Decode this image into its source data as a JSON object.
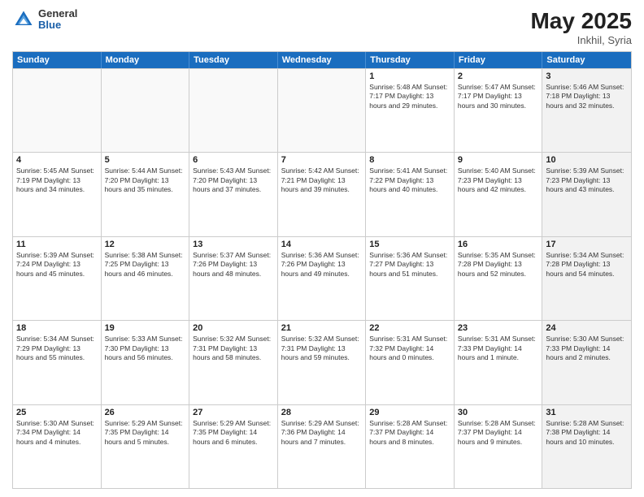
{
  "header": {
    "logo_general": "General",
    "logo_blue": "Blue",
    "month_title": "May 2025",
    "location": "Inkhil, Syria"
  },
  "days": [
    "Sunday",
    "Monday",
    "Tuesday",
    "Wednesday",
    "Thursday",
    "Friday",
    "Saturday"
  ],
  "weeks": [
    [
      {
        "day": "",
        "text": "",
        "shaded": false,
        "empty": true
      },
      {
        "day": "",
        "text": "",
        "shaded": false,
        "empty": true
      },
      {
        "day": "",
        "text": "",
        "shaded": false,
        "empty": true
      },
      {
        "day": "",
        "text": "",
        "shaded": false,
        "empty": true
      },
      {
        "day": "1",
        "text": "Sunrise: 5:48 AM\nSunset: 7:17 PM\nDaylight: 13 hours\nand 29 minutes.",
        "shaded": false,
        "empty": false
      },
      {
        "day": "2",
        "text": "Sunrise: 5:47 AM\nSunset: 7:17 PM\nDaylight: 13 hours\nand 30 minutes.",
        "shaded": false,
        "empty": false
      },
      {
        "day": "3",
        "text": "Sunrise: 5:46 AM\nSunset: 7:18 PM\nDaylight: 13 hours\nand 32 minutes.",
        "shaded": true,
        "empty": false
      }
    ],
    [
      {
        "day": "4",
        "text": "Sunrise: 5:45 AM\nSunset: 7:19 PM\nDaylight: 13 hours\nand 34 minutes.",
        "shaded": false,
        "empty": false
      },
      {
        "day": "5",
        "text": "Sunrise: 5:44 AM\nSunset: 7:20 PM\nDaylight: 13 hours\nand 35 minutes.",
        "shaded": false,
        "empty": false
      },
      {
        "day": "6",
        "text": "Sunrise: 5:43 AM\nSunset: 7:20 PM\nDaylight: 13 hours\nand 37 minutes.",
        "shaded": false,
        "empty": false
      },
      {
        "day": "7",
        "text": "Sunrise: 5:42 AM\nSunset: 7:21 PM\nDaylight: 13 hours\nand 39 minutes.",
        "shaded": false,
        "empty": false
      },
      {
        "day": "8",
        "text": "Sunrise: 5:41 AM\nSunset: 7:22 PM\nDaylight: 13 hours\nand 40 minutes.",
        "shaded": false,
        "empty": false
      },
      {
        "day": "9",
        "text": "Sunrise: 5:40 AM\nSunset: 7:23 PM\nDaylight: 13 hours\nand 42 minutes.",
        "shaded": false,
        "empty": false
      },
      {
        "day": "10",
        "text": "Sunrise: 5:39 AM\nSunset: 7:23 PM\nDaylight: 13 hours\nand 43 minutes.",
        "shaded": true,
        "empty": false
      }
    ],
    [
      {
        "day": "11",
        "text": "Sunrise: 5:39 AM\nSunset: 7:24 PM\nDaylight: 13 hours\nand 45 minutes.",
        "shaded": false,
        "empty": false
      },
      {
        "day": "12",
        "text": "Sunrise: 5:38 AM\nSunset: 7:25 PM\nDaylight: 13 hours\nand 46 minutes.",
        "shaded": false,
        "empty": false
      },
      {
        "day": "13",
        "text": "Sunrise: 5:37 AM\nSunset: 7:26 PM\nDaylight: 13 hours\nand 48 minutes.",
        "shaded": false,
        "empty": false
      },
      {
        "day": "14",
        "text": "Sunrise: 5:36 AM\nSunset: 7:26 PM\nDaylight: 13 hours\nand 49 minutes.",
        "shaded": false,
        "empty": false
      },
      {
        "day": "15",
        "text": "Sunrise: 5:36 AM\nSunset: 7:27 PM\nDaylight: 13 hours\nand 51 minutes.",
        "shaded": false,
        "empty": false
      },
      {
        "day": "16",
        "text": "Sunrise: 5:35 AM\nSunset: 7:28 PM\nDaylight: 13 hours\nand 52 minutes.",
        "shaded": false,
        "empty": false
      },
      {
        "day": "17",
        "text": "Sunrise: 5:34 AM\nSunset: 7:28 PM\nDaylight: 13 hours\nand 54 minutes.",
        "shaded": true,
        "empty": false
      }
    ],
    [
      {
        "day": "18",
        "text": "Sunrise: 5:34 AM\nSunset: 7:29 PM\nDaylight: 13 hours\nand 55 minutes.",
        "shaded": false,
        "empty": false
      },
      {
        "day": "19",
        "text": "Sunrise: 5:33 AM\nSunset: 7:30 PM\nDaylight: 13 hours\nand 56 minutes.",
        "shaded": false,
        "empty": false
      },
      {
        "day": "20",
        "text": "Sunrise: 5:32 AM\nSunset: 7:31 PM\nDaylight: 13 hours\nand 58 minutes.",
        "shaded": false,
        "empty": false
      },
      {
        "day": "21",
        "text": "Sunrise: 5:32 AM\nSunset: 7:31 PM\nDaylight: 13 hours\nand 59 minutes.",
        "shaded": false,
        "empty": false
      },
      {
        "day": "22",
        "text": "Sunrise: 5:31 AM\nSunset: 7:32 PM\nDaylight: 14 hours\nand 0 minutes.",
        "shaded": false,
        "empty": false
      },
      {
        "day": "23",
        "text": "Sunrise: 5:31 AM\nSunset: 7:33 PM\nDaylight: 14 hours\nand 1 minute.",
        "shaded": false,
        "empty": false
      },
      {
        "day": "24",
        "text": "Sunrise: 5:30 AM\nSunset: 7:33 PM\nDaylight: 14 hours\nand 2 minutes.",
        "shaded": true,
        "empty": false
      }
    ],
    [
      {
        "day": "25",
        "text": "Sunrise: 5:30 AM\nSunset: 7:34 PM\nDaylight: 14 hours\nand 4 minutes.",
        "shaded": false,
        "empty": false
      },
      {
        "day": "26",
        "text": "Sunrise: 5:29 AM\nSunset: 7:35 PM\nDaylight: 14 hours\nand 5 minutes.",
        "shaded": false,
        "empty": false
      },
      {
        "day": "27",
        "text": "Sunrise: 5:29 AM\nSunset: 7:35 PM\nDaylight: 14 hours\nand 6 minutes.",
        "shaded": false,
        "empty": false
      },
      {
        "day": "28",
        "text": "Sunrise: 5:29 AM\nSunset: 7:36 PM\nDaylight: 14 hours\nand 7 minutes.",
        "shaded": false,
        "empty": false
      },
      {
        "day": "29",
        "text": "Sunrise: 5:28 AM\nSunset: 7:37 PM\nDaylight: 14 hours\nand 8 minutes.",
        "shaded": false,
        "empty": false
      },
      {
        "day": "30",
        "text": "Sunrise: 5:28 AM\nSunset: 7:37 PM\nDaylight: 14 hours\nand 9 minutes.",
        "shaded": false,
        "empty": false
      },
      {
        "day": "31",
        "text": "Sunrise: 5:28 AM\nSunset: 7:38 PM\nDaylight: 14 hours\nand 10 minutes.",
        "shaded": true,
        "empty": false
      }
    ]
  ]
}
